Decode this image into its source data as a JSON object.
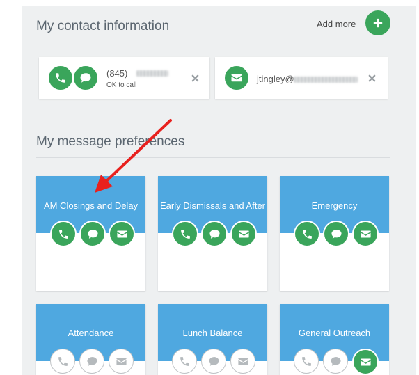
{
  "contact": {
    "title": "My contact information",
    "add_more_label": "Add more",
    "phone": {
      "number_prefix": "(845)",
      "status": "OK to call"
    },
    "email": {
      "address_prefix": "jtingley@"
    }
  },
  "preferences": {
    "title": "My message preferences",
    "cards": [
      {
        "label": "AM Closings and Delay",
        "call": true,
        "text": true,
        "email": true
      },
      {
        "label": "Early Dismissals and After",
        "call": true,
        "text": true,
        "email": true
      },
      {
        "label": "Emergency",
        "call": true,
        "text": true,
        "email": true
      },
      {
        "label": "Attendance",
        "call": false,
        "text": false,
        "email": false
      },
      {
        "label": "Lunch Balance",
        "call": false,
        "text": false,
        "email": false
      },
      {
        "label": "General Outreach",
        "call": false,
        "text": false,
        "email": true
      }
    ]
  },
  "colors": {
    "green": "#3aa55b",
    "blue": "#4fa8e0",
    "annotation_arrow": "#e8211e"
  },
  "icons": [
    "plus-icon",
    "phone-icon",
    "chat-icon",
    "envelope-icon",
    "close-icon",
    "arrow-annotation"
  ]
}
